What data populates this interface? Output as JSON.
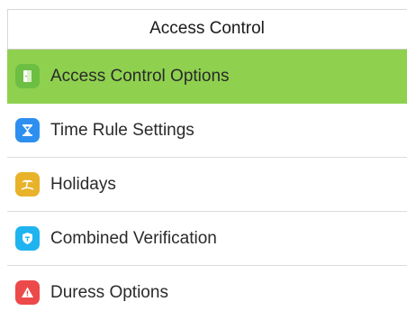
{
  "header": {
    "title": "Access Control"
  },
  "menu": {
    "items": [
      {
        "label": "Access Control Options",
        "icon": "door-icon",
        "icon_color": "#6cbf43",
        "selected": true
      },
      {
        "label": "Time Rule Settings",
        "icon": "hourglass-icon",
        "icon_color": "#2d8ff0",
        "selected": false
      },
      {
        "label": "Holidays",
        "icon": "beach-icon",
        "icon_color": "#e8b32a",
        "selected": false
      },
      {
        "label": "Combined Verification",
        "icon": "shield-icon",
        "icon_color": "#1fb4ef",
        "selected": false
      },
      {
        "label": "Duress Options",
        "icon": "warning-icon",
        "icon_color": "#ec4a4a",
        "selected": false
      }
    ]
  },
  "colors": {
    "selected_row": "#8fd14f",
    "divider": "#dcdcdc"
  }
}
